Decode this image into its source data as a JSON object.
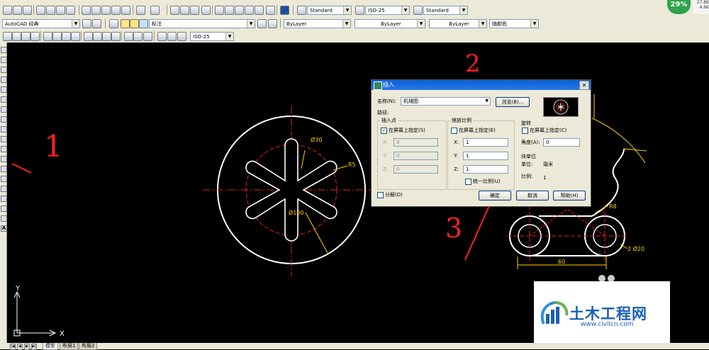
{
  "toolbar": {
    "text_style": "Standard",
    "dim_style": "ISO-25",
    "table_style": "Standard",
    "workspace": "AutoCAD 经典",
    "annotation_label": "标注",
    "layer_color": "ByLayer",
    "linetype": "ByLayer",
    "lineweight": "ByLayer",
    "plot_style": "随颜色",
    "dim_style_2": "ISO-25"
  },
  "status": {
    "badge": "29%",
    "net_up": "27.8K",
    "net_down": "4.6K"
  },
  "dialog": {
    "title": "插入",
    "name_label": "名称(N):",
    "name_value": "机械图",
    "browse": "浏览(B)...",
    "path_label": "路径:",
    "insert_group": "插入点",
    "insert_onscreen": "在屏幕上指定(S)",
    "x_label": "X:",
    "y_label": "Y:",
    "z_label": "Z:",
    "ix": "0",
    "iy": "0",
    "iz": "0",
    "scale_group": "缩放比例",
    "scale_onscreen": "在屏幕上指定(E)",
    "sx": "1",
    "sy": "1",
    "sz": "1",
    "uniform": "统一比例(U)",
    "rot_group": "旋转",
    "rot_onscreen": "在屏幕上指定(C)",
    "angle_label": "角度(A):",
    "angle": "0",
    "unit_group": "块单位",
    "unit_label": "单位:",
    "unit_value": "毫米",
    "ratio_label": "比例:",
    "ratio_value": "1",
    "explode": "分解(D)",
    "ok": "确定",
    "cancel": "取消",
    "help": "帮助(H)"
  },
  "drawing": {
    "dim_phi30": "Ø30",
    "dim_r5": "R5",
    "dim_phi100": "Ø100",
    "dim_r8": "R8",
    "dim_2phi20": "2 Ø20",
    "dim_60": "60",
    "ucs_x": "X",
    "ucs_y": "Y"
  },
  "annotations": {
    "a1": "1",
    "a2": "2",
    "a3": "3"
  },
  "tabs": {
    "model": "模型",
    "layout1": "布局1",
    "layout2": "布局2"
  },
  "watermark": {
    "title": "土木工程网",
    "url": "www.civilcn.com"
  },
  "colors": {
    "canvas": "#000000",
    "geometry": "#ffffff",
    "centerline": "#ff2020",
    "dimension": "#ffff00",
    "annotation": "#ff2020",
    "titlebar": "#0a5fd8"
  }
}
